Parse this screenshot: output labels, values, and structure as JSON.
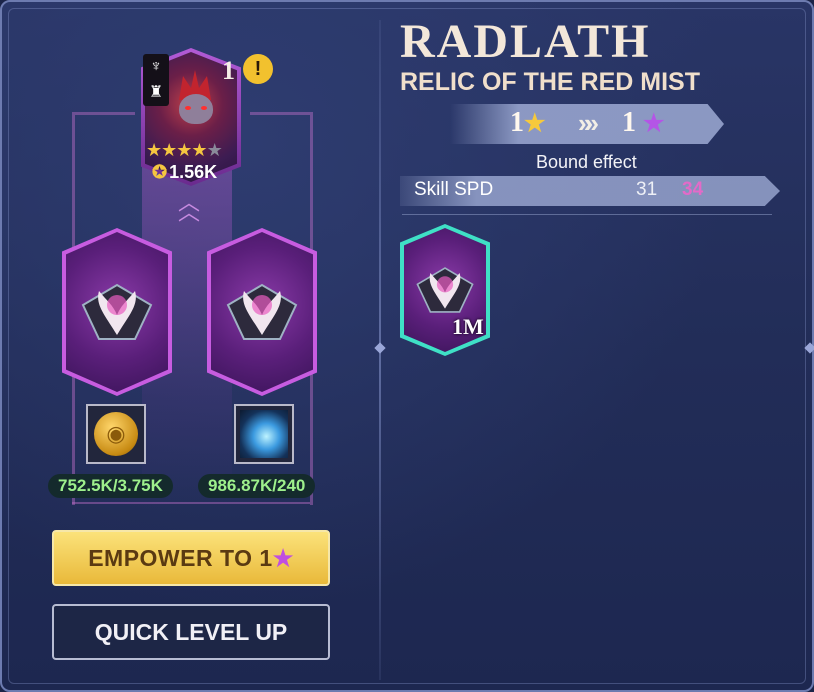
{
  "hero": {
    "level": "1",
    "stars_total": 5,
    "stars_filled": 4,
    "power": "1.56K",
    "warning_icon": "exclamation-triangle-icon"
  },
  "materials": [
    {
      "icon": "gold-coin-icon",
      "amount": "752.5K/3.75K"
    },
    {
      "icon": "lightning-essence-icon",
      "amount": "986.87K/240"
    }
  ],
  "buttons": {
    "empower_label": "EMPOWER TO 1",
    "quick_level_label": "QUICK LEVEL UP"
  },
  "relic": {
    "name": "RADLATH",
    "subtitle": "RELIC OF THE RED MIST",
    "current_level": "1",
    "next_level": "1",
    "bound_effect_label": "Bound effect",
    "stat_name": "Skill SPD",
    "stat_current": "31",
    "stat_next": "34",
    "owned_relic_value": "1M"
  },
  "colors": {
    "accent_gold": "#f5c640",
    "accent_purple": "#c04fe0",
    "stat_increase": "#e36ac8",
    "resource_green": "#9ef08c"
  }
}
